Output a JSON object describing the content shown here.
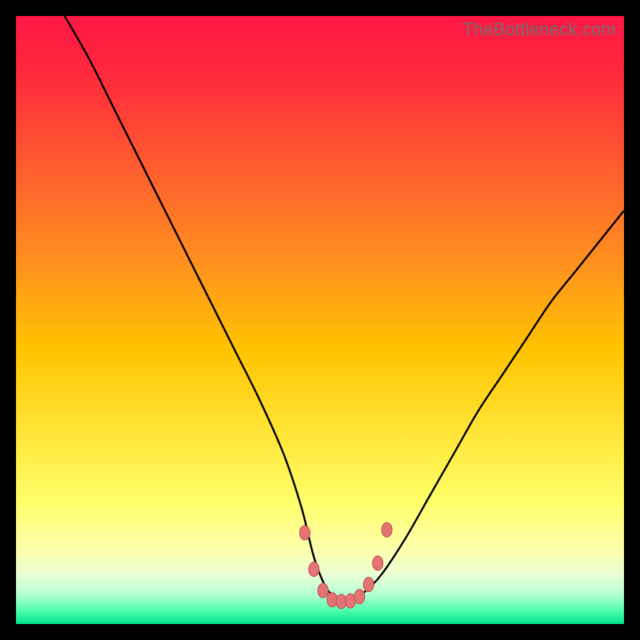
{
  "watermark": "TheBottleneck.com",
  "colors": {
    "frame": "#000000",
    "curve": "#000000",
    "marker_fill": "#e57373",
    "marker_stroke": "#b84f4f",
    "gradient_stops": [
      {
        "offset": 0.0,
        "color": "#ff1744"
      },
      {
        "offset": 0.1,
        "color": "#ff2a3c"
      },
      {
        "offset": 0.25,
        "color": "#ff5d2e"
      },
      {
        "offset": 0.4,
        "color": "#ff8f1f"
      },
      {
        "offset": 0.55,
        "color": "#ffc400"
      },
      {
        "offset": 0.7,
        "color": "#ffe83d"
      },
      {
        "offset": 0.8,
        "color": "#ffff6a"
      },
      {
        "offset": 0.88,
        "color": "#fdffae"
      },
      {
        "offset": 0.92,
        "color": "#e9ffd6"
      },
      {
        "offset": 0.95,
        "color": "#b8ffd4"
      },
      {
        "offset": 0.975,
        "color": "#5cffb0"
      },
      {
        "offset": 1.0,
        "color": "#00e58b"
      }
    ]
  },
  "chart_data": {
    "type": "line",
    "title": "",
    "xlabel": "",
    "ylabel": "",
    "xlim": [
      0,
      100
    ],
    "ylim": [
      0,
      100
    ],
    "series": [
      {
        "name": "bottleneck-curve",
        "x": [
          8,
          12,
          16,
          20,
          24,
          28,
          32,
          36,
          40,
          44,
          47,
          49,
          51,
          53,
          55,
          57,
          60,
          64,
          68,
          72,
          76,
          80,
          84,
          88,
          92,
          96,
          100
        ],
        "y": [
          100,
          93,
          85,
          77,
          69,
          61,
          53,
          45,
          37,
          28,
          19,
          11,
          6,
          4,
          4,
          5,
          8,
          14,
          21,
          28,
          35,
          41,
          47,
          53,
          58,
          63,
          68
        ]
      }
    ],
    "markers": {
      "name": "trough-markers",
      "x": [
        47.5,
        49.0,
        50.5,
        52.0,
        53.5,
        55.0,
        56.5,
        58.0,
        59.5,
        61.0
      ],
      "y": [
        15.0,
        9.0,
        5.5,
        4.0,
        3.7,
        3.8,
        4.5,
        6.5,
        10.0,
        15.5
      ]
    }
  }
}
